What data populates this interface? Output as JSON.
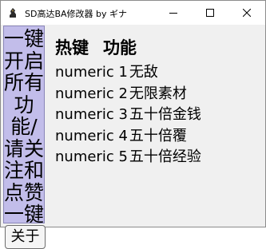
{
  "window": {
    "title": "SD高达BA修改器 by ギナ",
    "controls": [
      "minimize-icon",
      "maximize-icon",
      "close-icon"
    ]
  },
  "sidebar": {
    "vertical_button_text": "一键开启所有功能/请关注和点赞一键三连",
    "about_label": "关于"
  },
  "main": {
    "col_hotkey": "热键",
    "col_function": "功能",
    "hotkeys": [
      {
        "key": "numeric 1",
        "func": "无敌"
      },
      {
        "key": "numeric 2",
        "func": "无限素材"
      },
      {
        "key": "numeric 3",
        "func": "五十倍金钱"
      },
      {
        "key": "numeric 4",
        "func": "五十倍覆"
      },
      {
        "key": "numeric 5",
        "func": "五十倍经验"
      }
    ]
  },
  "colors": {
    "vertical_button_bg": "#c2bdea",
    "window_bg": "#f0f0f0",
    "titlebar_bg": "#ffffff"
  }
}
